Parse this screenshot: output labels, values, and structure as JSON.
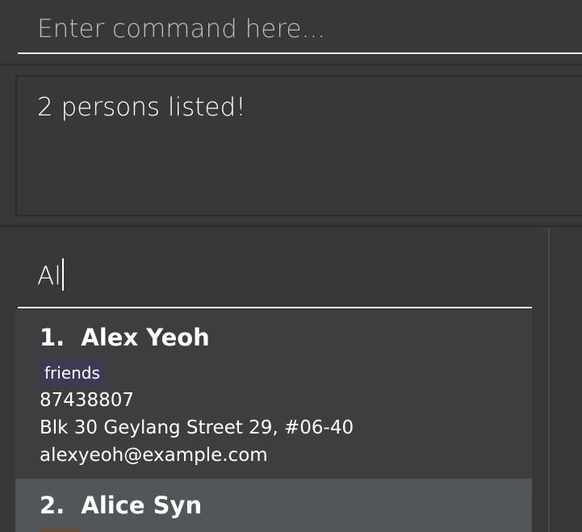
{
  "command_box": {
    "placeholder": "Enter command here..."
  },
  "result_display": {
    "message": "2 persons listed!"
  },
  "search": {
    "value": "Al"
  },
  "persons": [
    {
      "title": "1.  Alex Yeoh",
      "tags": [
        "friends"
      ],
      "phone": "87438807",
      "address": "Blk 30 Geylang Street 29, #06-40",
      "email": "alexyeoh@example.com"
    },
    {
      "title": "2.  Alice Syn"
    }
  ],
  "colors": {
    "background": "#383838",
    "card_default": "#3c3e3f",
    "card_selected": "#515658",
    "tag_friends": "#3e3a54",
    "tag_second": "#6b4a2e",
    "text": "#ffffff"
  }
}
